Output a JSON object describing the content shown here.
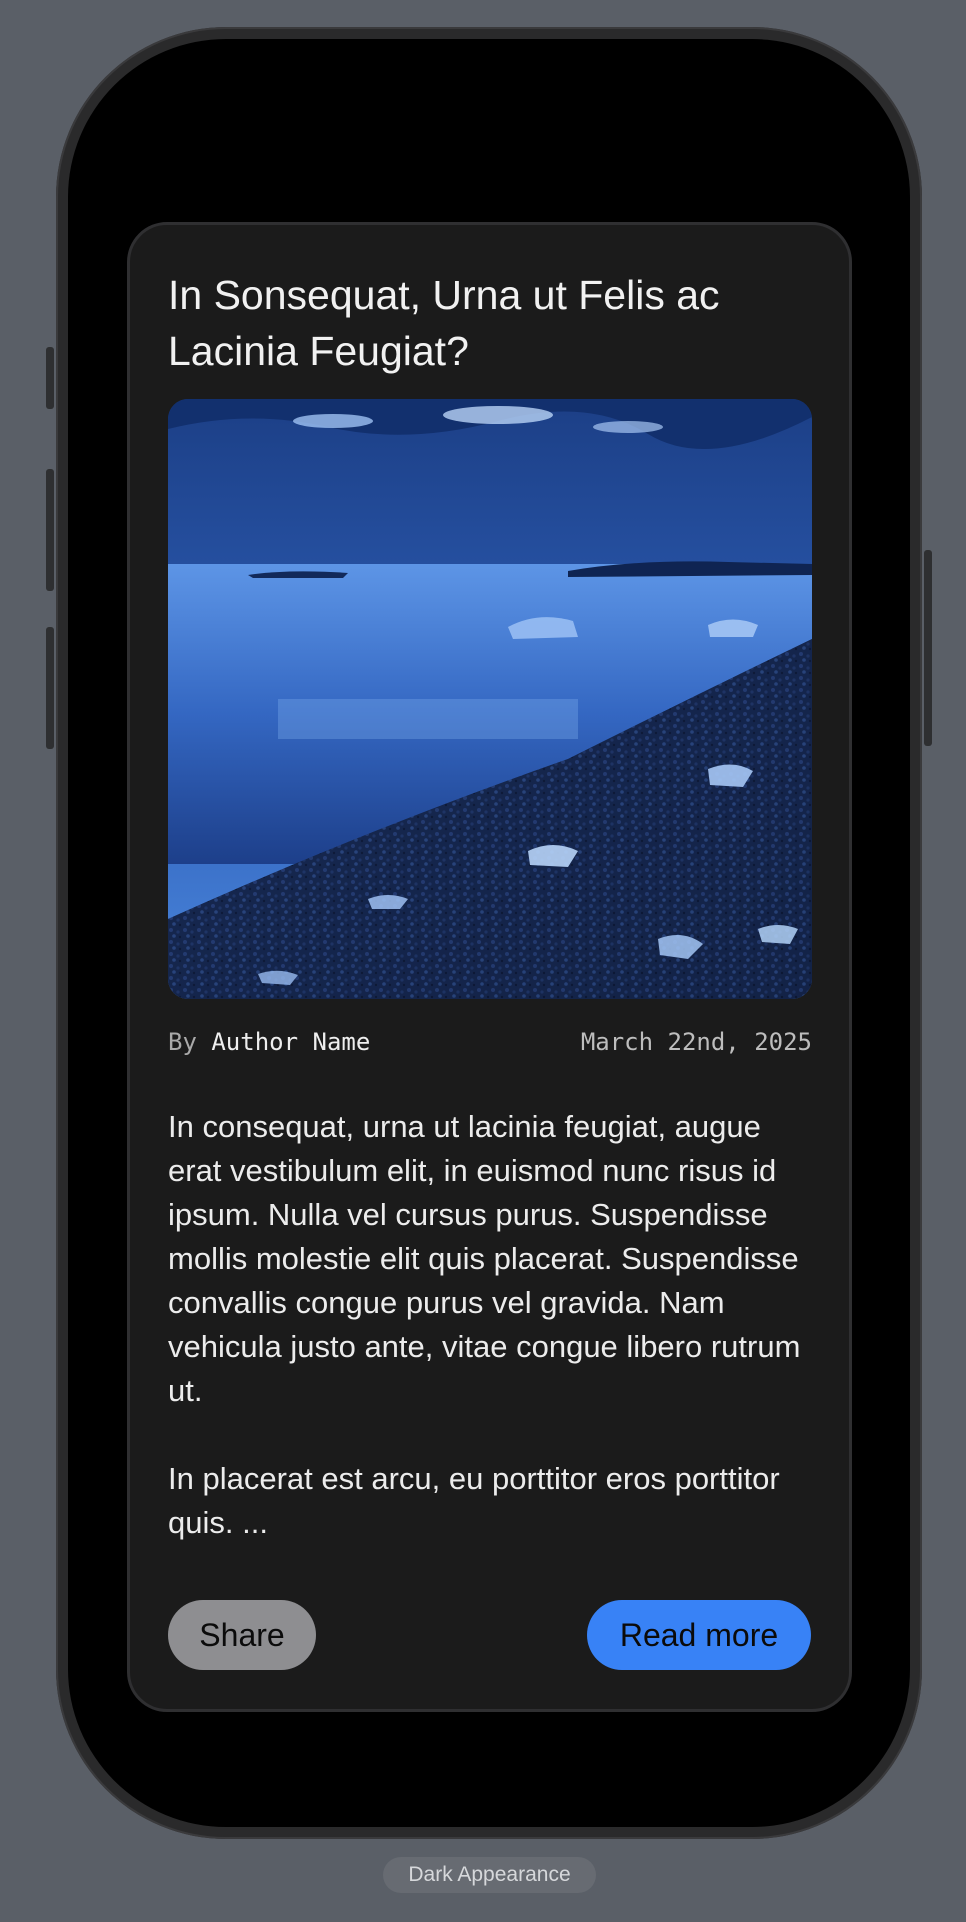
{
  "article": {
    "title": "In Sonsequat, Urna ut Felis ac Lacinia Feugiat?",
    "byline_prefix": "By",
    "author": "Author Name",
    "date": "March 22nd, 2025",
    "paragraphs": [
      "In consequat, urna ut lacinia feugiat, augue erat vestibulum elit, in euismod nunc risus id ipsum. Nulla vel cursus purus. Suspendisse mollis molestie elit quis placerat. Suspendisse convallis congue purus vel gravida. Nam vehicula justo ante, vitae congue libero rutrum ut.",
      "In placerat est arcu, eu porttitor eros porttitor quis. ..."
    ]
  },
  "actions": {
    "share_label": "Share",
    "read_more_label": "Read more"
  },
  "footer": {
    "appearance_label": "Dark Appearance"
  },
  "colors": {
    "page_background": "#5a5f67",
    "card_background": "#1b1b1b",
    "primary_button": "#3882f6",
    "secondary_button": "#8e8e91"
  }
}
